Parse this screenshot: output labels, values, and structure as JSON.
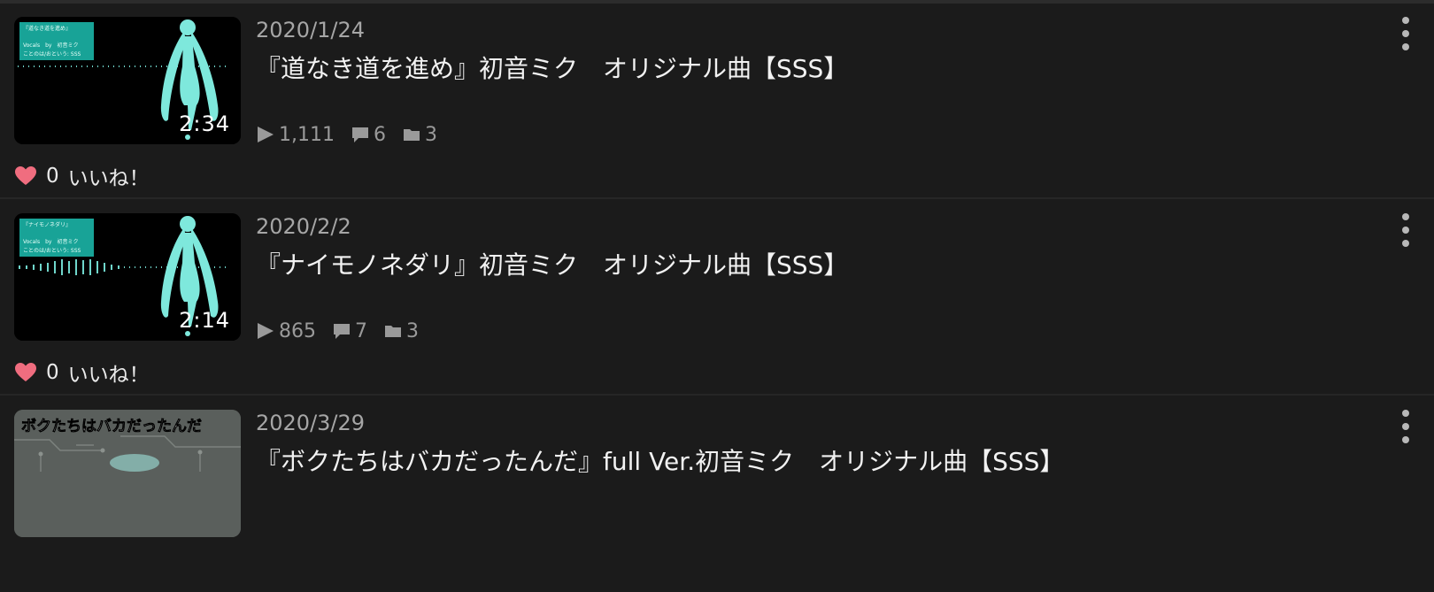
{
  "videos": [
    {
      "date": "2020/1/24",
      "title": "『道なき道を進め』初音ミク　オリジナル曲【SSS】",
      "duration": "2:34",
      "views": "1,111",
      "comments": "6",
      "mylists": "3",
      "likes": "0",
      "likes_label": "いいね！",
      "thumb_lines": [
        "『道なき道を進め』",
        "Vocals　by　初音ミク",
        "ことのは/おというː SSS"
      ]
    },
    {
      "date": "2020/2/2",
      "title": "『ナイモノネダリ』初音ミク　オリジナル曲【SSS】",
      "duration": "2:14",
      "views": "865",
      "comments": "7",
      "mylists": "3",
      "likes": "0",
      "likes_label": "いいね！",
      "thumb_lines": [
        "『ナイモノネダリ』",
        "Vocals　by　初音ミク",
        "ことのは/おというː SSS"
      ]
    },
    {
      "date": "2020/3/29",
      "title": "『ボクたちはバカだったんだ』full Ver.初音ミク　オリジナル曲【SSS】",
      "thumb_text": "ボクたちはバカだったんだ"
    }
  ],
  "icons": {
    "play": "play-icon",
    "comment": "comment-icon",
    "folder": "folder-icon",
    "heart": "heart-icon",
    "more": "more-vertical-icon"
  },
  "colors": {
    "background": "#1b1b1b",
    "heart": "#f06d7f",
    "teal": "#18a397",
    "miku": "#7ee8dc"
  }
}
